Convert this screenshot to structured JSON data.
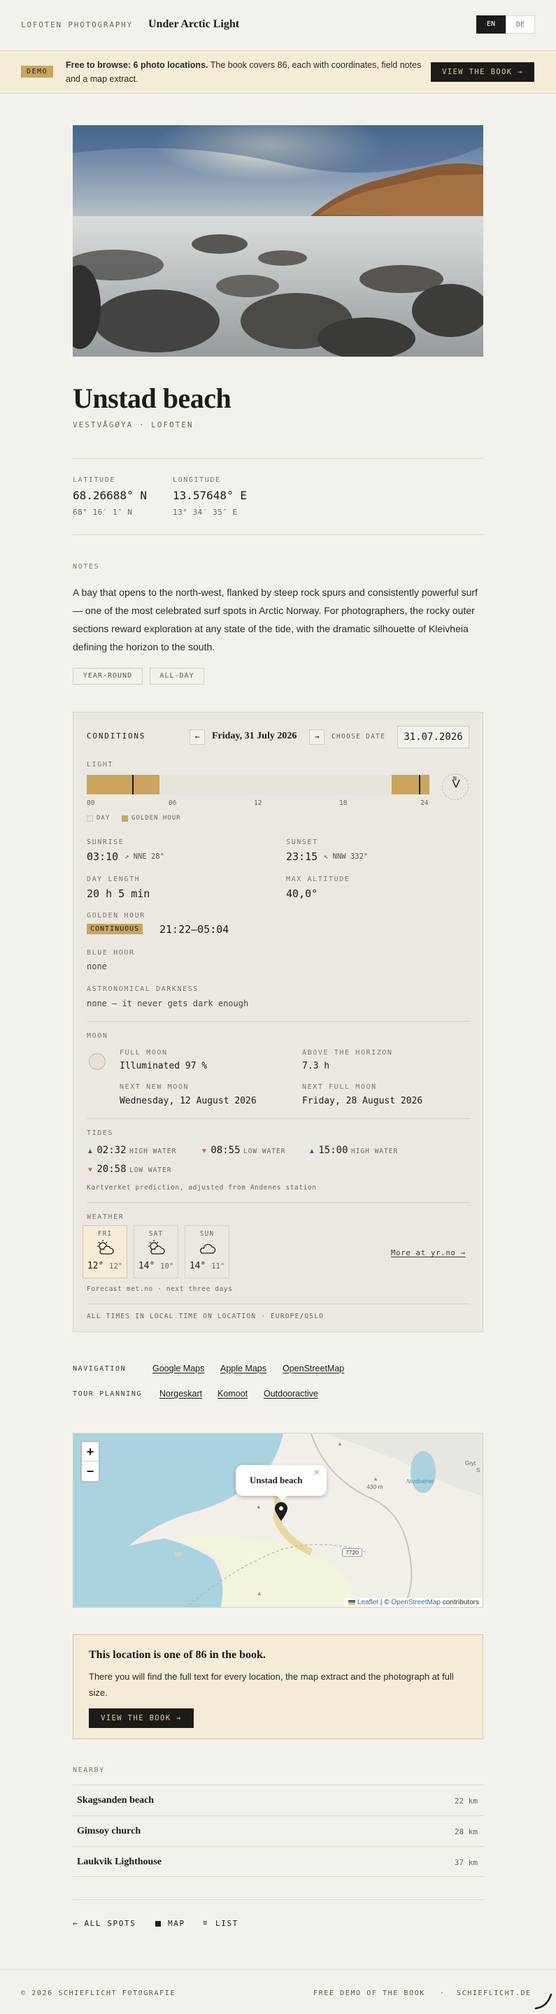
{
  "header": {
    "brand": "LOFOTEN PHOTOGRAPHY",
    "title": "Under Arctic Light",
    "lang_en": "EN",
    "lang_de": "DE"
  },
  "banner": {
    "badge": "DEMO",
    "strong": "Free to browse: 6 photo locations.",
    "text": " The book covers 86, each with coordinates, field notes and a map extract.",
    "cta": "VIEW THE BOOK →"
  },
  "location": {
    "name": "Unstad beach",
    "region": "VESTVÅGØYA · LOFOTEN"
  },
  "coords": {
    "lat_label": "LATITUDE",
    "lat": "68.26688° N",
    "lat_dms": "68° 16′ 1″ N",
    "lon_label": "LONGITUDE",
    "lon": "13.57648° E",
    "lon_dms": "13° 34′ 35″ E"
  },
  "notes": {
    "label": "NOTES",
    "text": "A bay that opens to the north-west, flanked by steep rock spurs and consistently powerful surf — one of the most celebrated surf spots in Arctic Norway. For photographers, the rocky outer sections reward exploration at any state of the tide, with the dramatic silhouette of Kleivheia defining the horizon to the south.",
    "tags": [
      "YEAR-ROUND",
      "ALL-DAY"
    ]
  },
  "conditions": {
    "label": "CONDITIONS",
    "prev": "←",
    "date": "Friday, 31 July 2026",
    "next": "→",
    "choose_label": "CHOOSE DATE",
    "date_value": "31.07.2026",
    "light_label": "LIGHT",
    "ticks": [
      "00",
      "06",
      "12",
      "18",
      "24"
    ],
    "legend_day": "DAY",
    "legend_golden": "GOLDEN HOUR",
    "compass": "N",
    "light_segments": {
      "golden_morning_end_h": 5.07,
      "golden_evening_start_h": 21.37,
      "now_h": 3.17,
      "sunset_h": 23.25
    },
    "sunrise_label": "SUNRISE",
    "sunrise": "03:10",
    "sunrise_dir": "↗ NNE 28°",
    "sunset_label": "SUNSET",
    "sunset": "23:15",
    "sunset_dir": "↖ NNW 332°",
    "day_length_label": "DAY LENGTH",
    "day_length": "20 h 5 min",
    "max_alt_label": "MAX ALTITUDE",
    "max_alt": "40,0°",
    "golden_label": "GOLDEN HOUR",
    "golden_badge": "CONTINUOUS",
    "golden_time": "21:22–05:04",
    "blue_label": "BLUE HOUR",
    "blue": "none",
    "dark_label": "ASTRONOMICAL DARKNESS",
    "dark": "none — it never gets dark enough",
    "moon_label": "MOON",
    "full_moon_label": "FULL MOON",
    "illuminated": "Illuminated 97 %",
    "above_label": "ABOVE THE HORIZON",
    "above": "7.3 h",
    "new_moon_label": "NEXT NEW MOON",
    "new_moon": "Wednesday, 12 August 2026",
    "next_full_label": "NEXT FULL MOON",
    "next_full": "Friday, 28 August 2026",
    "tides_label": "TIDES",
    "tides": [
      {
        "arrow": "▲",
        "time": "02:32",
        "kind": "HIGH WATER"
      },
      {
        "arrow": "▼",
        "time": "08:55",
        "kind": "LOW WATER"
      },
      {
        "arrow": "▲",
        "time": "15:00",
        "kind": "HIGH WATER"
      },
      {
        "arrow": "▼",
        "time": "20:58",
        "kind": "LOW WATER"
      }
    ],
    "tide_note": "Kartverket prediction, adjusted from Andenes station",
    "weather_label": "WEATHER",
    "weather": [
      {
        "day": "FRI",
        "hi": "12°",
        "lo": "12°",
        "icon": "partly-sunny-icon"
      },
      {
        "day": "SAT",
        "hi": "14°",
        "lo": "10°",
        "icon": "partly-sunny-icon"
      },
      {
        "day": "SUN",
        "hi": "14°",
        "lo": "11°",
        "icon": "cloud-icon"
      }
    ],
    "yr_link": "More at yr.no →",
    "forecast_note": "Forecast met.no · next three days",
    "tz_note": "ALL TIMES IN LOCAL TIME ON LOCATION · EUROPE/OSLO"
  },
  "navigation": {
    "label": "NAVIGATION",
    "links": [
      "Google Maps",
      "Apple Maps",
      "OpenStreetMap"
    ]
  },
  "tour": {
    "label": "TOUR PLANNING",
    "links": [
      "Norgeskart",
      "Komoot",
      "Outdooractive"
    ]
  },
  "map": {
    "zoom_in": "+",
    "zoom_out": "−",
    "popup": "Unstad beach",
    "close": "×",
    "elev": "430 m",
    "road": "7720",
    "place": "Nordvatnet",
    "place2": "Gryt",
    "place3": "S",
    "attr_leaflet": "Leaflet",
    "attr_sep": " | © ",
    "attr_osm": "OpenStreetMap",
    "attr_tail": " contributors"
  },
  "promo": {
    "title": "This location is one of 86 in the book.",
    "text": "There you will find the full text for every location, the map extract and the photograph at full size.",
    "cta": "VIEW THE BOOK →"
  },
  "nearby": {
    "label": "NEARBY",
    "items": [
      {
        "name": "Skagsanden beach",
        "dist": "22 km"
      },
      {
        "name": "Gimsoy church",
        "dist": "28 km"
      },
      {
        "name": "Laukvik Lighthouse",
        "dist": "37 km"
      }
    ]
  },
  "bottom_nav": {
    "all": "← ALL SPOTS",
    "map": "MAP",
    "list": "LIST"
  },
  "footer": {
    "copy": "© 2026 SCHIEFLICHT FOTOGRAFIE",
    "demo": "FREE DEMO OF THE BOOK",
    "sep": "·",
    "site": "SCHIEFLICHT.DE"
  },
  "colors": {
    "bg": "#f3f1ec",
    "golden": "#c9a55f",
    "banner_bg": "#f5ecd8",
    "dark": "#1c1b19",
    "day": "#e9e4d9",
    "link_blue": "#2a6fb0",
    "high_tide": "#3c5d86",
    "low_tide": "#b07840"
  }
}
